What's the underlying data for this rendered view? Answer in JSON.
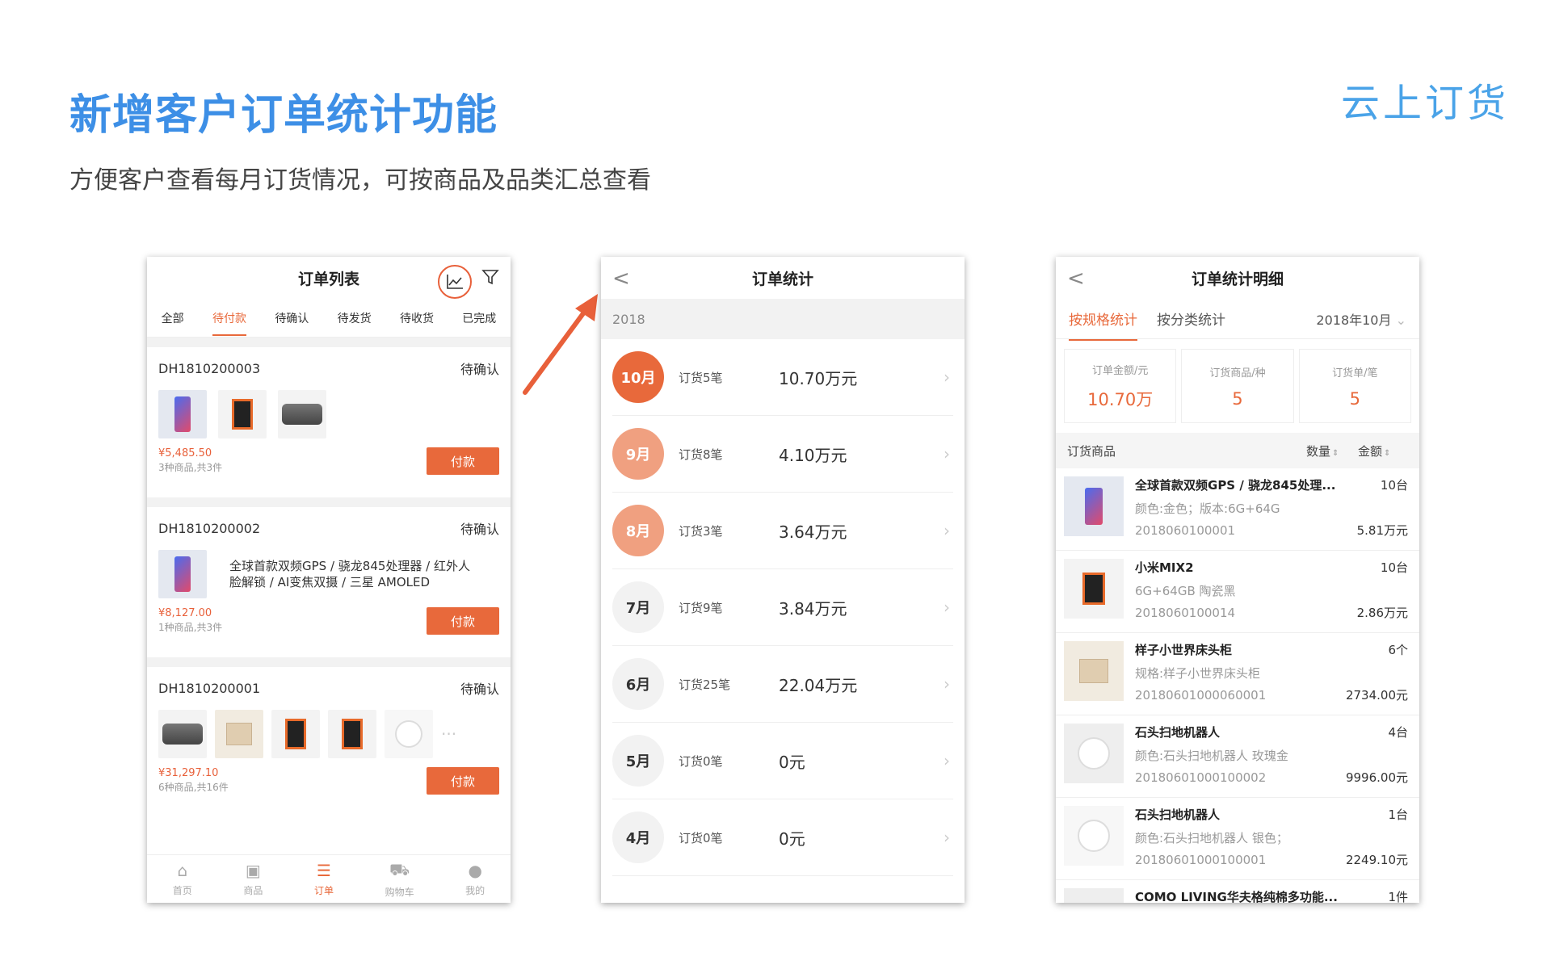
{
  "slide": {
    "title": "新增客户订单统计功能",
    "subtitle": "方便客户查看每月订货情况，可按商品及品类汇总查看",
    "brand": "云上订货",
    "accent_color": "#3d8fe6",
    "highlight_color": "#e8693b"
  },
  "screen1": {
    "title": "订单列表",
    "tabs": [
      "全部",
      "待付款",
      "待确认",
      "待发货",
      "待收货",
      "已完成"
    ],
    "active_tab": "待付款",
    "orders": [
      {
        "id": "DH1810200003",
        "status": "待确认",
        "price": "¥5,485.50",
        "count": "3种商品,共3件",
        "pay": "付款"
      },
      {
        "id": "DH1810200002",
        "status": "待确认",
        "desc1": "全球首款双频GPS / 骁龙845处理器 / 红外人",
        "desc2": "脸解锁 / AI变焦双摄 / 三星 AMOLED",
        "price": "¥8,127.00",
        "count": "1种商品,共3件",
        "pay": "付款"
      },
      {
        "id": "DH1810200001",
        "status": "待确认",
        "price": "¥31,297.10",
        "count": "6种商品,共16件",
        "pay": "付款",
        "more": "···"
      }
    ],
    "tabbar": [
      "首页",
      "商品",
      "订单",
      "购物车",
      "我的"
    ]
  },
  "screen2": {
    "title": "订单统计",
    "back": "<",
    "year": "2018",
    "months": [
      {
        "month": "10月",
        "count": "订货5笔",
        "amount": "10.70万元",
        "level": "strong"
      },
      {
        "month": "9月",
        "count": "订货8笔",
        "amount": "4.10万元",
        "level": "mid"
      },
      {
        "month": "8月",
        "count": "订货3笔",
        "amount": "3.64万元",
        "level": "mid"
      },
      {
        "month": "7月",
        "count": "订货9笔",
        "amount": "3.84万元",
        "level": "none"
      },
      {
        "month": "6月",
        "count": "订货25笔",
        "amount": "22.04万元",
        "level": "none"
      },
      {
        "month": "5月",
        "count": "订货0笔",
        "amount": "0元",
        "level": "none"
      },
      {
        "month": "4月",
        "count": "订货0笔",
        "amount": "0元",
        "level": "none"
      }
    ]
  },
  "screen3": {
    "title": "订单统计明细",
    "back": "<",
    "tabs": [
      "按规格统计",
      "按分类统计"
    ],
    "month_select": "2018年10月",
    "stats": [
      {
        "label": "订单金额/元",
        "value": "10.70万"
      },
      {
        "label": "订货商品/种",
        "value": "5"
      },
      {
        "label": "订货单/笔",
        "value": "5"
      }
    ],
    "list_header": "订货商品",
    "sort_qty": "数量",
    "sort_amt": "金额",
    "items": [
      {
        "name": "全球首款双频GPS / 骁龙845处理...",
        "spec": "颜色:金色；版本:6G+64G",
        "code": "2018060100001",
        "qty": "10台",
        "amount": "5.81万元"
      },
      {
        "name": "小米MIX2",
        "spec": "6G+64GB 陶瓷黑",
        "code": "2018060100014",
        "qty": "10台",
        "amount": "2.86万元"
      },
      {
        "name": "样子小世界床头柜",
        "spec": "规格:样子小世界床头柜",
        "code": "20180601000060001",
        "qty": "6个",
        "amount": "2734.00元"
      },
      {
        "name": "石头扫地机器人",
        "spec": "颜色:石头扫地机器人 玫瑰金",
        "code": "20180601000100002",
        "qty": "4台",
        "amount": "9996.00元"
      },
      {
        "name": "石头扫地机器人",
        "spec": "颜色:石头扫地机器人 银色；",
        "code": "20180601000100001",
        "qty": "1台",
        "amount": "2249.10元"
      },
      {
        "name": "COMO LIVING华夫格纯棉多功能...",
        "spec": "",
        "code": "",
        "qty": "1件",
        "amount": ""
      }
    ]
  }
}
